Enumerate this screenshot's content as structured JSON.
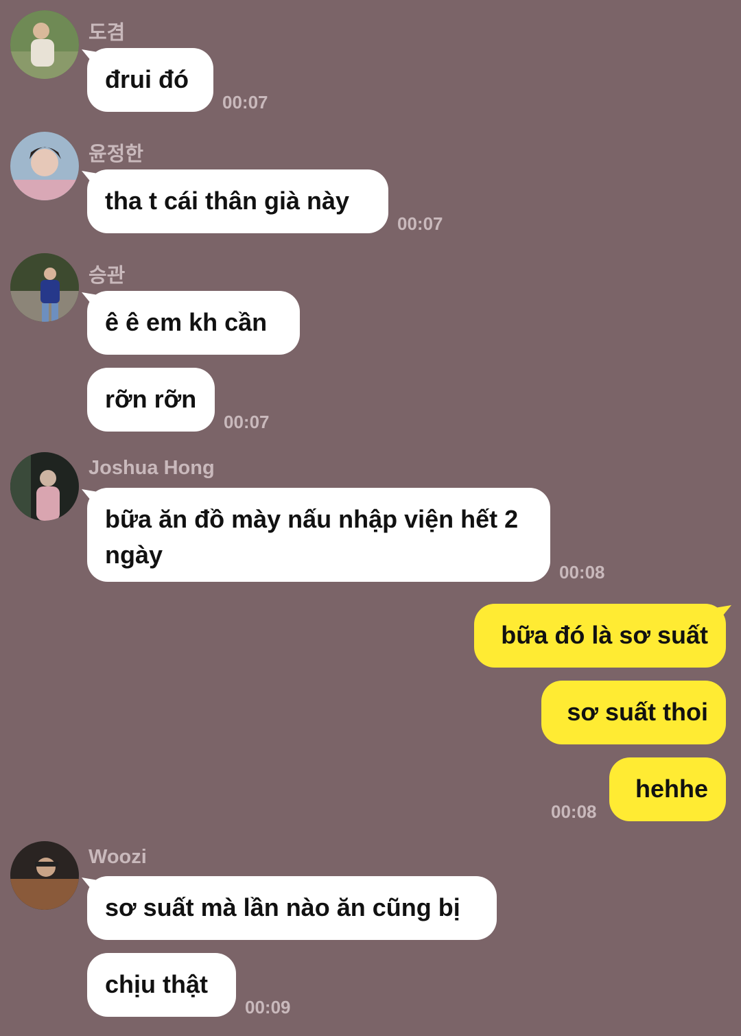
{
  "colors": {
    "background": "#7b6468",
    "incoming": "#ffffff",
    "outgoing": "#ffeb33",
    "meta_text": "#c9b9bc"
  },
  "messages": [
    {
      "sender": "도겸",
      "avatar": "avatar-photo-icon",
      "bubbles": [
        "đrui đó"
      ],
      "time": "00:07"
    },
    {
      "sender": "윤정한",
      "avatar": "avatar-photo-icon",
      "bubbles": [
        "tha t cái thân già này"
      ],
      "time": "00:07"
    },
    {
      "sender": "승관",
      "avatar": "avatar-photo-icon",
      "bubbles": [
        "ê ê em kh cần",
        "rỡn rỡn"
      ],
      "time": "00:07"
    },
    {
      "sender": "Joshua Hong",
      "avatar": "avatar-photo-icon",
      "bubbles": [
        "bữa ăn đồ mày nấu nhập viện hết 2 ngày"
      ],
      "time": "00:08"
    },
    {
      "sender": "me",
      "bubbles": [
        "bữa đó là sơ suất",
        "sơ suất thoi",
        "hehhe"
      ],
      "time": "00:08"
    },
    {
      "sender": "Woozi",
      "avatar": "avatar-photo-icon",
      "bubbles": [
        "sơ suất mà lần nào ăn cũng bị",
        "chịu thật"
      ],
      "time": "00:09"
    }
  ]
}
